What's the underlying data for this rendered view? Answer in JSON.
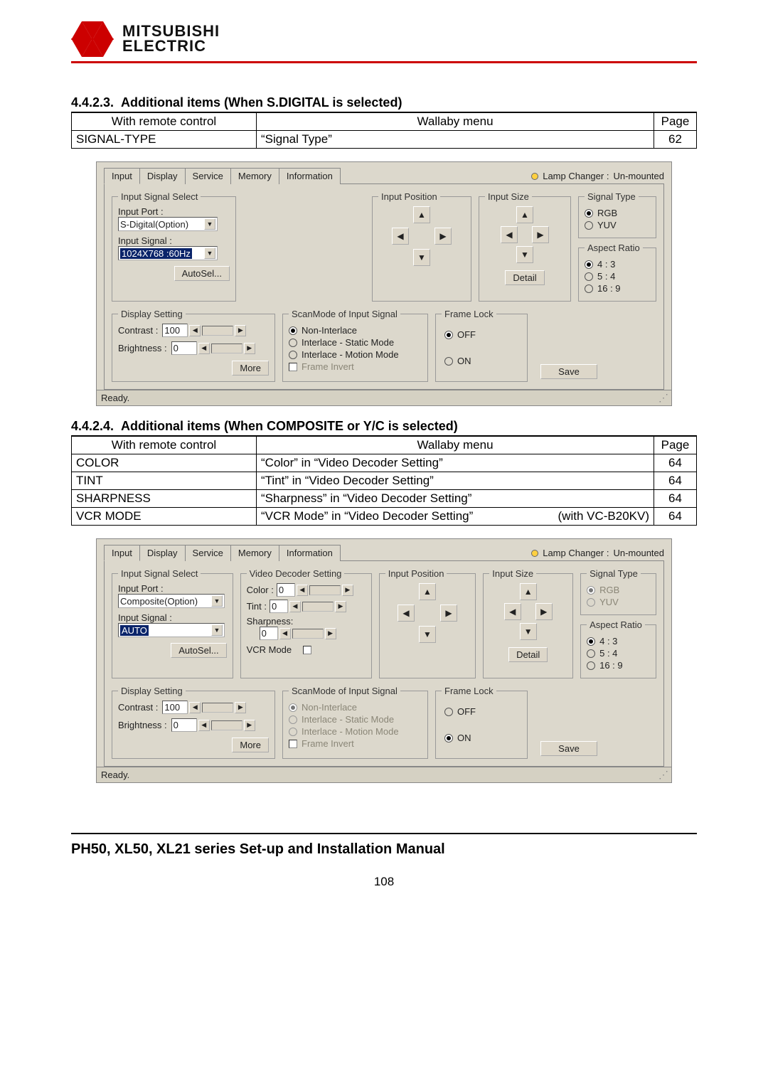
{
  "brand": {
    "line1": "MITSUBISHI",
    "line2": "ELECTRIC"
  },
  "section1": {
    "number": "4.4.2.3.",
    "title": "Additional items (When S.DIGITAL is selected)",
    "headers": {
      "c1": "With remote control",
      "c2": "Wallaby menu",
      "c3": "Page"
    },
    "rows": [
      {
        "c1": "SIGNAL-TYPE",
        "c2": "“Signal Type”",
        "c3": "62"
      }
    ]
  },
  "section2": {
    "number": "4.4.2.4.",
    "title": "Additional items (When COMPOSITE or Y/C is selected)",
    "headers": {
      "c1": "With remote control",
      "c2": "Wallaby menu",
      "c3": "Page"
    },
    "rows": [
      {
        "c1": "COLOR",
        "c2": "“Color” in “Video Decoder Setting”",
        "c3": "64"
      },
      {
        "c1": "TINT",
        "c2": "“Tint” in “Video Decoder Setting”",
        "c3": "64"
      },
      {
        "c1": "SHARPNESS",
        "c2": "“Sharpness” in “Video Decoder Setting”",
        "c3": "64"
      },
      {
        "c1": "VCR MODE",
        "c2": "“VCR Mode” in “Video Decoder Setting”",
        "note": "(with VC-B20KV)",
        "c3": "64"
      }
    ]
  },
  "common": {
    "tabs": [
      "Input",
      "Display",
      "Service",
      "Memory",
      "Information"
    ],
    "lamp_label": "Lamp Changer :",
    "lamp_value": "Un-mounted",
    "groups": {
      "input_select": "Input Signal Select",
      "input_port": "Input Port :",
      "input_signal": "Input Signal :",
      "autosel": "AutoSel...",
      "input_position": "Input Position",
      "input_size": "Input Size",
      "detail": "Detail",
      "signal_type": "Signal Type",
      "aspect_ratio": "Aspect Ratio",
      "display_setting": "Display Setting",
      "contrast": "Contrast :",
      "brightness": "Brightness :",
      "more": "More",
      "scanmode": "ScanMode of Input Signal",
      "frame_lock": "Frame Lock",
      "save": "Save",
      "video_decoder": "Video Decoder Setting",
      "color": "Color :",
      "tint": "Tint :",
      "sharpness": "Sharpness:",
      "vcr_mode": "VCR Mode"
    },
    "radios": {
      "rgb": "RGB",
      "yuv": "YUV",
      "r43": "4 : 3",
      "r54": "5 : 4",
      "r169": "16 : 9",
      "non_interlace": "Non-Interlace",
      "int_static": "Interlace - Static Mode",
      "int_motion": "Interlace - Motion Mode",
      "frame_invert": "Frame Invert",
      "off": "OFF",
      "on": "ON"
    },
    "status": "Ready."
  },
  "shot1": {
    "input_port": "S-Digital(Option)",
    "input_signal": "1024X768  :60Hz",
    "contrast": "100",
    "brightness": "0",
    "frame_lock_on": false,
    "scan_enabled": true,
    "signal_type_enabled": true
  },
  "shot2": {
    "input_port": "Composite(Option)",
    "input_signal": "AUTO",
    "color": "0",
    "tint": "0",
    "sharpness": "0",
    "contrast": "100",
    "brightness": "0",
    "frame_lock_on": true,
    "scan_enabled": false,
    "signal_type_enabled": false
  },
  "footer": {
    "title": "PH50, XL50, XL21 series Set-up and Installation Manual",
    "page": "108"
  }
}
